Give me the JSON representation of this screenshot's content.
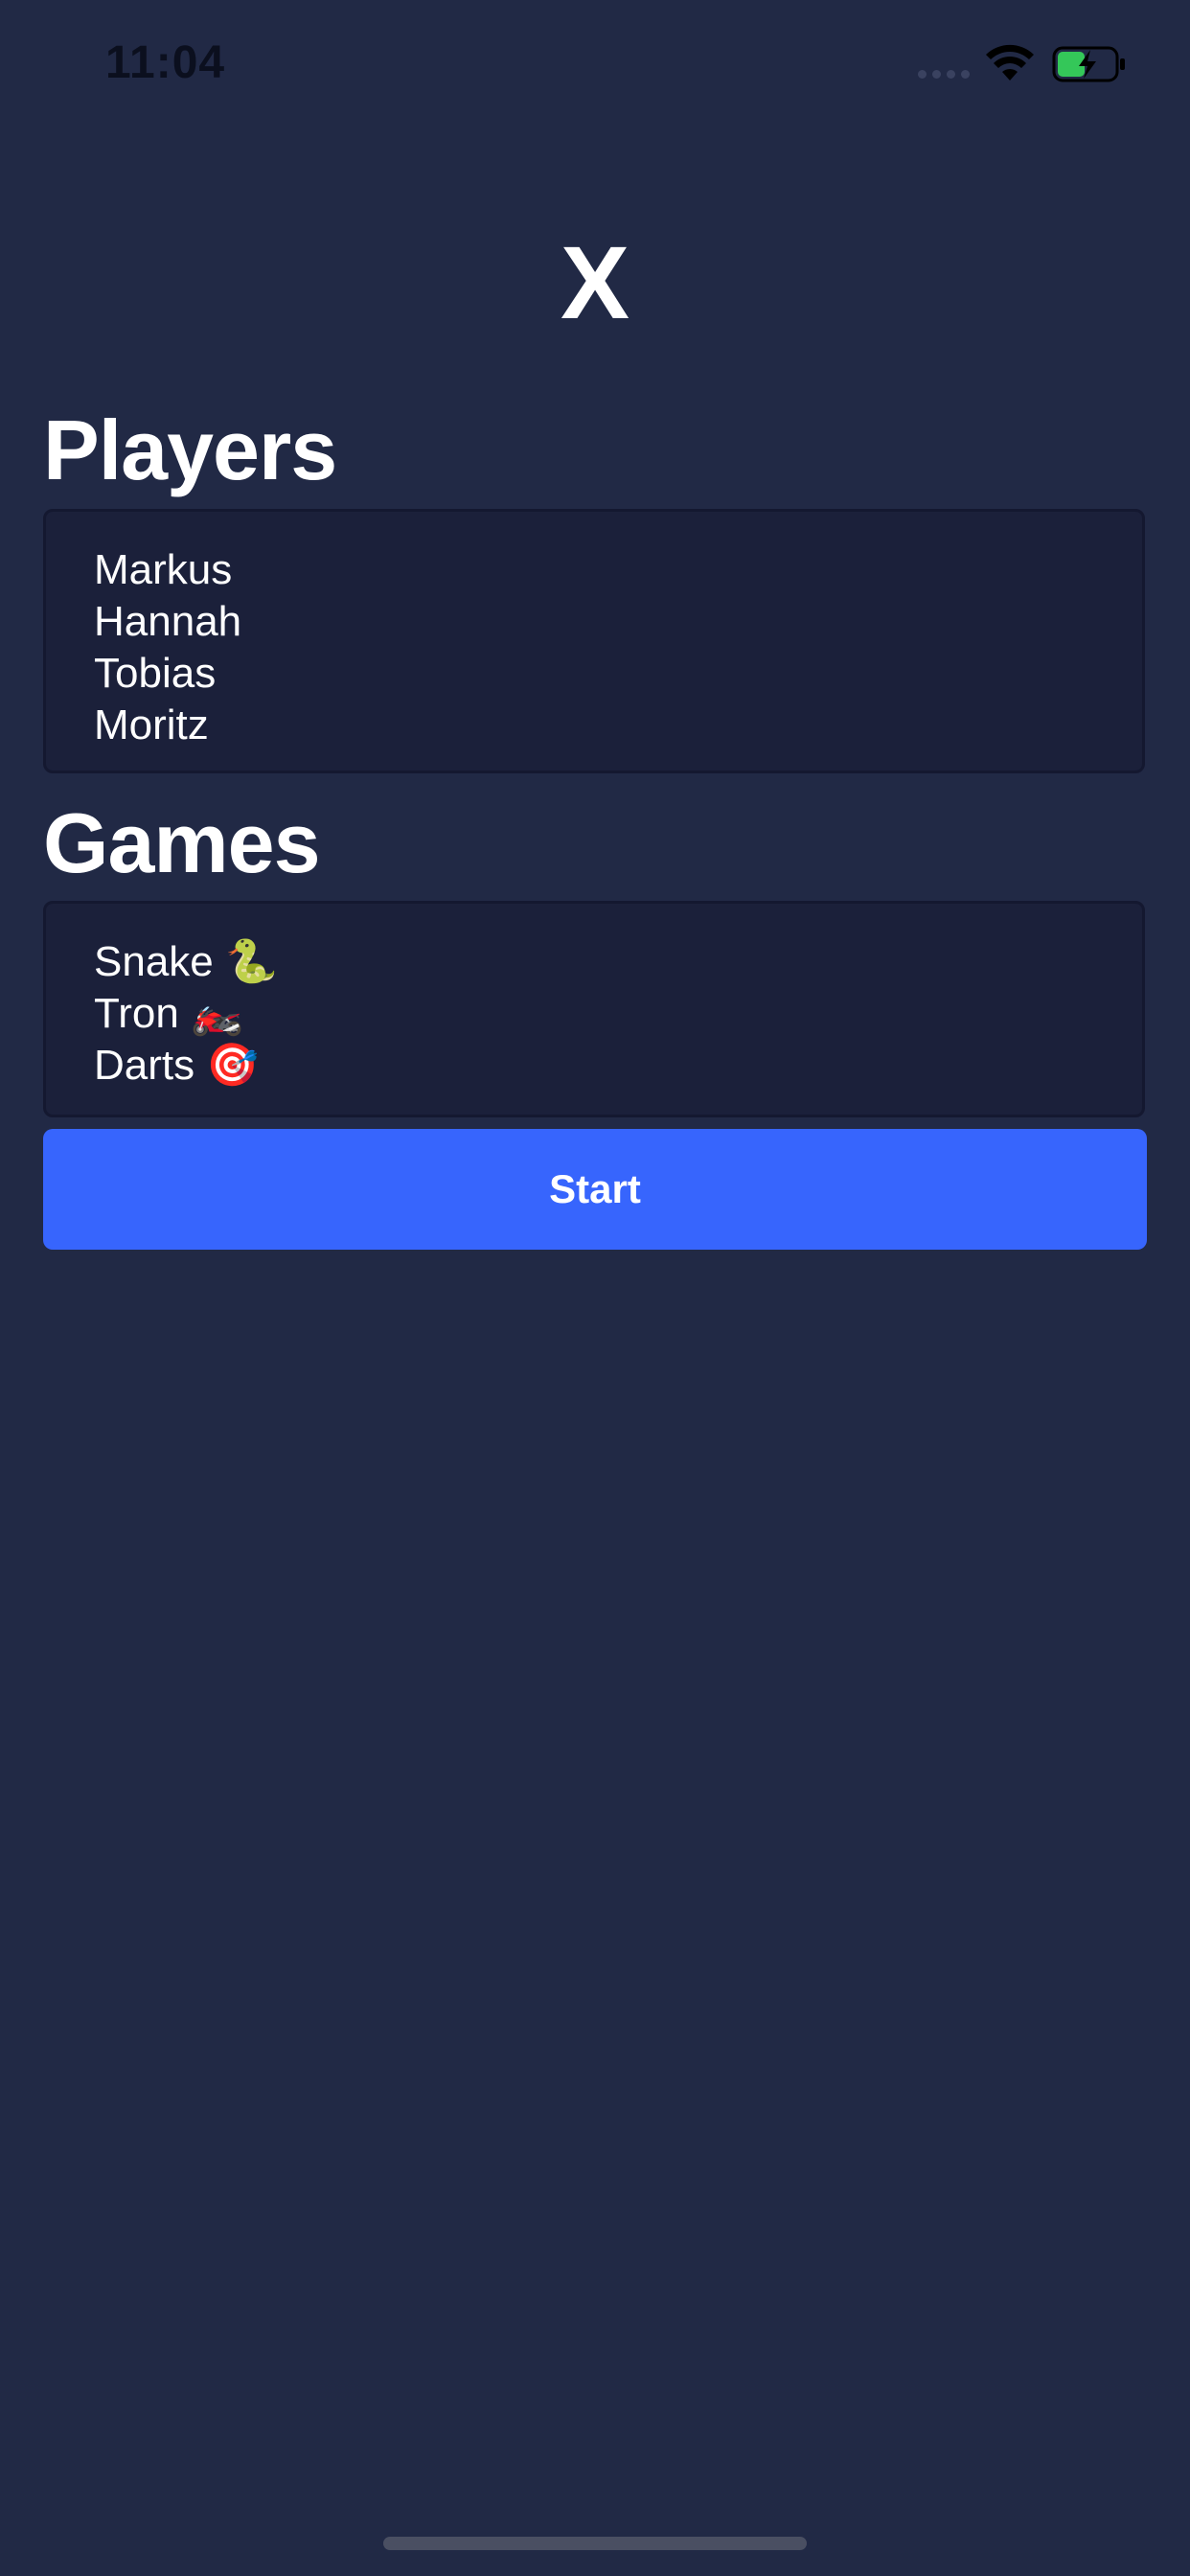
{
  "status_bar": {
    "time": "11:04",
    "icons": [
      "cellular-dots-icon",
      "wifi-icon",
      "battery-charging-icon"
    ],
    "battery_color": "#34c759"
  },
  "app": {
    "title": "X"
  },
  "players": {
    "heading": "Players",
    "items": [
      "Markus",
      "Hannah",
      "Tobias",
      "Moritz"
    ]
  },
  "games": {
    "heading": "Games",
    "items": [
      {
        "name": "Snake",
        "emoji": "🐍"
      },
      {
        "name": "Tron",
        "emoji": "🏍️"
      },
      {
        "name": "Darts",
        "emoji": "🎯"
      }
    ]
  },
  "start_button": {
    "label": "Start",
    "color": "#3765fd"
  },
  "colors": {
    "background": "#212945",
    "list_background": "#1b203a"
  }
}
